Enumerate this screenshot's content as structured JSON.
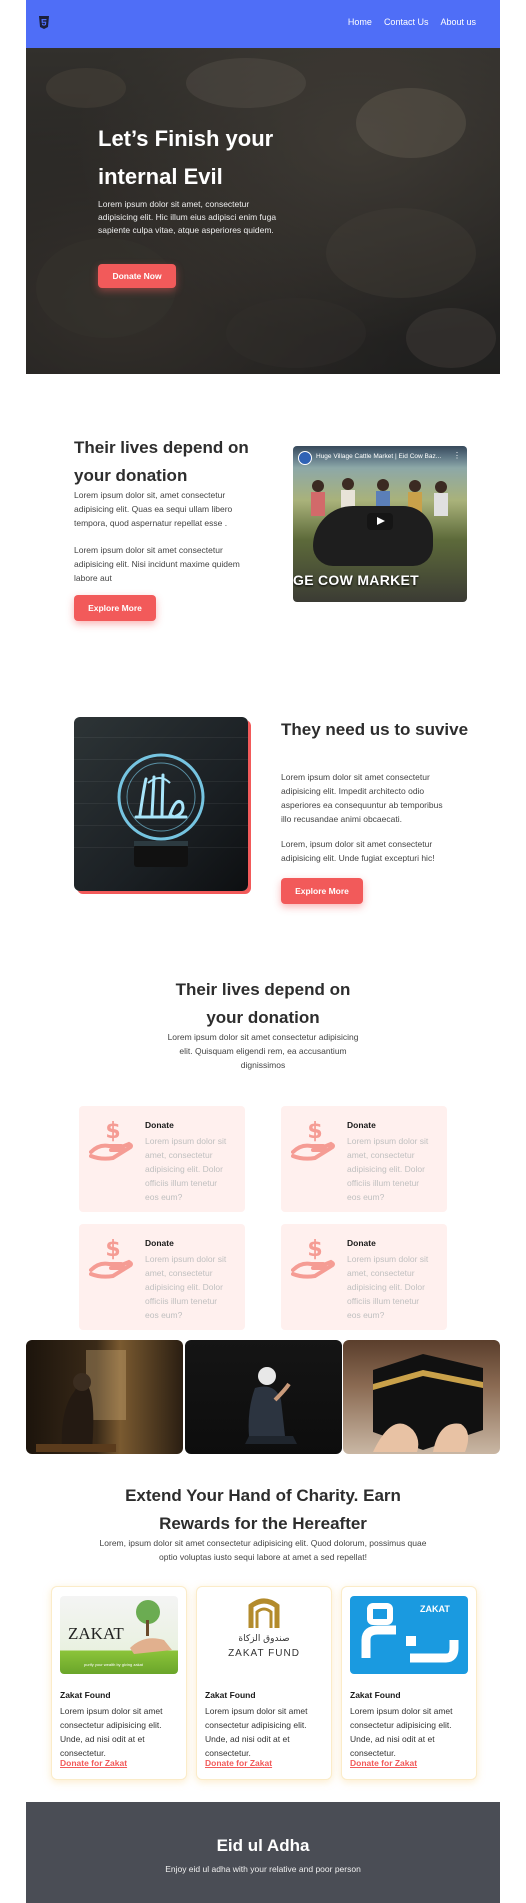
{
  "nav": {
    "logo_icon": "html5-icon",
    "links": [
      "Home",
      "Contact Us",
      "About us"
    ],
    "background": "#4f6ef7"
  },
  "hero": {
    "title": "Let’s Finish your internal Evil",
    "text": "Lorem ipsum dolor sit amet, consectetur adipisicing elit. Hic illum eius adipisci enim fuga sapiente culpa vitae, atque asperiores quidem.",
    "button": "Donate Now"
  },
  "section1": {
    "title": "Their lives depend on your donation",
    "paragraph1": "Lorem ipsum dolor sit, amet consectetur adipisicing elit. Quas ea sequi ullam libero tempora, quod aspernatur repellat esse .",
    "paragraph2": "Lorem ipsum dolor sit amet consectetur adipisicing elit. Nisi incidunt maxime quidem labore aut",
    "button": "Explore More",
    "video": {
      "title": "Huge Village Cattle Market | Eid Cow Baz...",
      "caption": "GE COW MARKET"
    }
  },
  "section2": {
    "title": "They need us to suvive",
    "paragraph1": "Lorem ipsum dolor sit amet consectetur adipisicing elit. Impedit architecto odio asperiores ea consequuntur ab temporibus illo recusandae animi obcaecati.",
    "paragraph2": "Lorem, ipsum dolor sit amet consectetur adipisicing elit. Unde fugiat excepturi hic!",
    "button": "Explore More"
  },
  "section3": {
    "title": "Their lives depend on your donation",
    "text": "Lorem ipsum dolor sit amet consectetur adipisicing elit. Quisquam eligendi rem, ea accusantium dignissimos",
    "cards": [
      {
        "title": "Donate",
        "text": "Lorem ipsum dolor sit amet, consectetur adipisicing elit. Dolor officiis illum tenetur eos eum?"
      },
      {
        "title": "Donate",
        "text": "Lorem ipsum dolor sit amet, consectetur adipisicing elit. Dolor officiis illum tenetur eos eum?"
      },
      {
        "title": "Donate",
        "text": "Lorem ipsum dolor sit amet, consectetur adipisicing elit. Dolor officiis illum tenetur eos eum?"
      },
      {
        "title": "Donate",
        "text": "Lorem ipsum dolor sit amet, consectetur adipisicing elit. Dolor officiis illum tenetur eos eum?"
      }
    ]
  },
  "charity": {
    "title": "Extend Your Hand of Charity. Earn Rewards for the Hereafter",
    "text": "Lorem, ipsum dolor sit amet consectetur adipisicing elit. Quod dolorum, possimus quae optio voluptas iusto sequi labore at amet a sed repellat!",
    "cards": [
      {
        "title": "Zakat Found",
        "text": "Lorem ipsum dolor sit amet consectetur adipisicing elit. Unde, ad nisi odit at et consectetur.",
        "link": "Donate for Zakat",
        "logo_text": "ZAKAT",
        "logo_sub": "purify your wealth by giving zakat"
      },
      {
        "title": "Zakat Found",
        "text": "Lorem ipsum dolor sit amet consectetur adipisicing elit. Unde, ad nisi odit at et consectetur.",
        "link": "Donate for Zakat",
        "logo_text": "ZAKAT FUND",
        "logo_sub": "صندوق الزكاة"
      },
      {
        "title": "Zakat Found",
        "text": "Lorem ipsum dolor sit amet consectetur adipisicing elit. Unde, ad nisi odit at et consectetur.",
        "link": "Donate for Zakat",
        "logo_text": "ZAKAT",
        "logo_sub": ""
      }
    ]
  },
  "footer": {
    "title": "Eid ul Adha",
    "text": "Enjoy eid ul adha with your relative and poor person",
    "background": "#4a4d55"
  },
  "colors": {
    "accent": "#f25a5a",
    "card_bg": "#fff0ee",
    "icon": "#f59c94"
  }
}
